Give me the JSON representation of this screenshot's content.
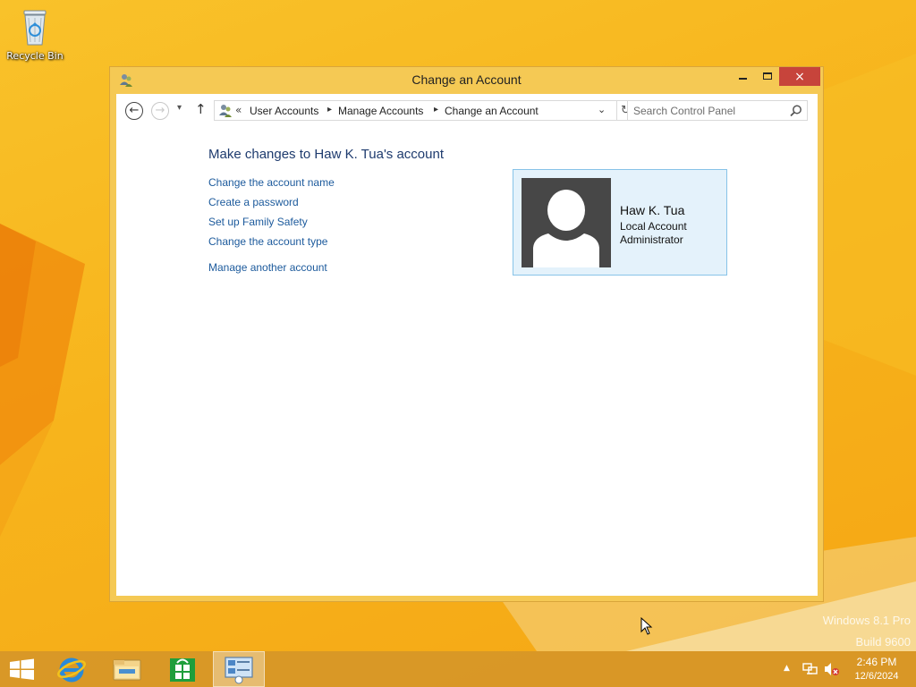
{
  "desktop": {
    "icons": [
      {
        "label": "Recycle Bin",
        "icon": "recycle-bin-icon"
      }
    ],
    "watermark": {
      "line1": "Windows 8.1 Pro",
      "line2": "Build 9600"
    }
  },
  "window": {
    "title": "Change an Account",
    "controls": {
      "minimize": "minimize-icon",
      "maximize": "maximize-icon",
      "close": "×"
    },
    "navigation": {
      "back": "←",
      "forward": "→",
      "recent": "▾",
      "up": "↑"
    },
    "address": {
      "chevron": "«",
      "breadcrumbs": [
        "User Accounts",
        "Manage Accounts",
        "Change an Account"
      ],
      "separator": "▸",
      "dropdown": "⌄",
      "refresh": "↻"
    },
    "search": {
      "placeholder": "Search Control Panel"
    }
  },
  "content": {
    "heading": "Make changes to Haw K. Tua's account",
    "tasks": [
      "Change the account name",
      "Create a password",
      "Set up Family Safety",
      "Change the account type"
    ],
    "other_task": "Manage another account",
    "account": {
      "name": "Haw K. Tua",
      "type": "Local Account",
      "role": "Administrator"
    }
  },
  "taskbar": {
    "pinned": [
      "start-icon",
      "internet-explorer-icon",
      "file-explorer-icon",
      "store-icon",
      "control-panel-icon"
    ],
    "tray": {
      "show_hidden": "▲"
    },
    "clock": {
      "time": "2:46 PM",
      "date": "12/6/2024"
    }
  },
  "colors": {
    "wallpaper": "#f7b81e",
    "window_frame": "#f5c954",
    "close_button": "#c7443b",
    "link": "#1c5a9c",
    "heading": "#1e3b6e",
    "card_background": "#e4f2fb",
    "card_border": "#87c3e8"
  }
}
